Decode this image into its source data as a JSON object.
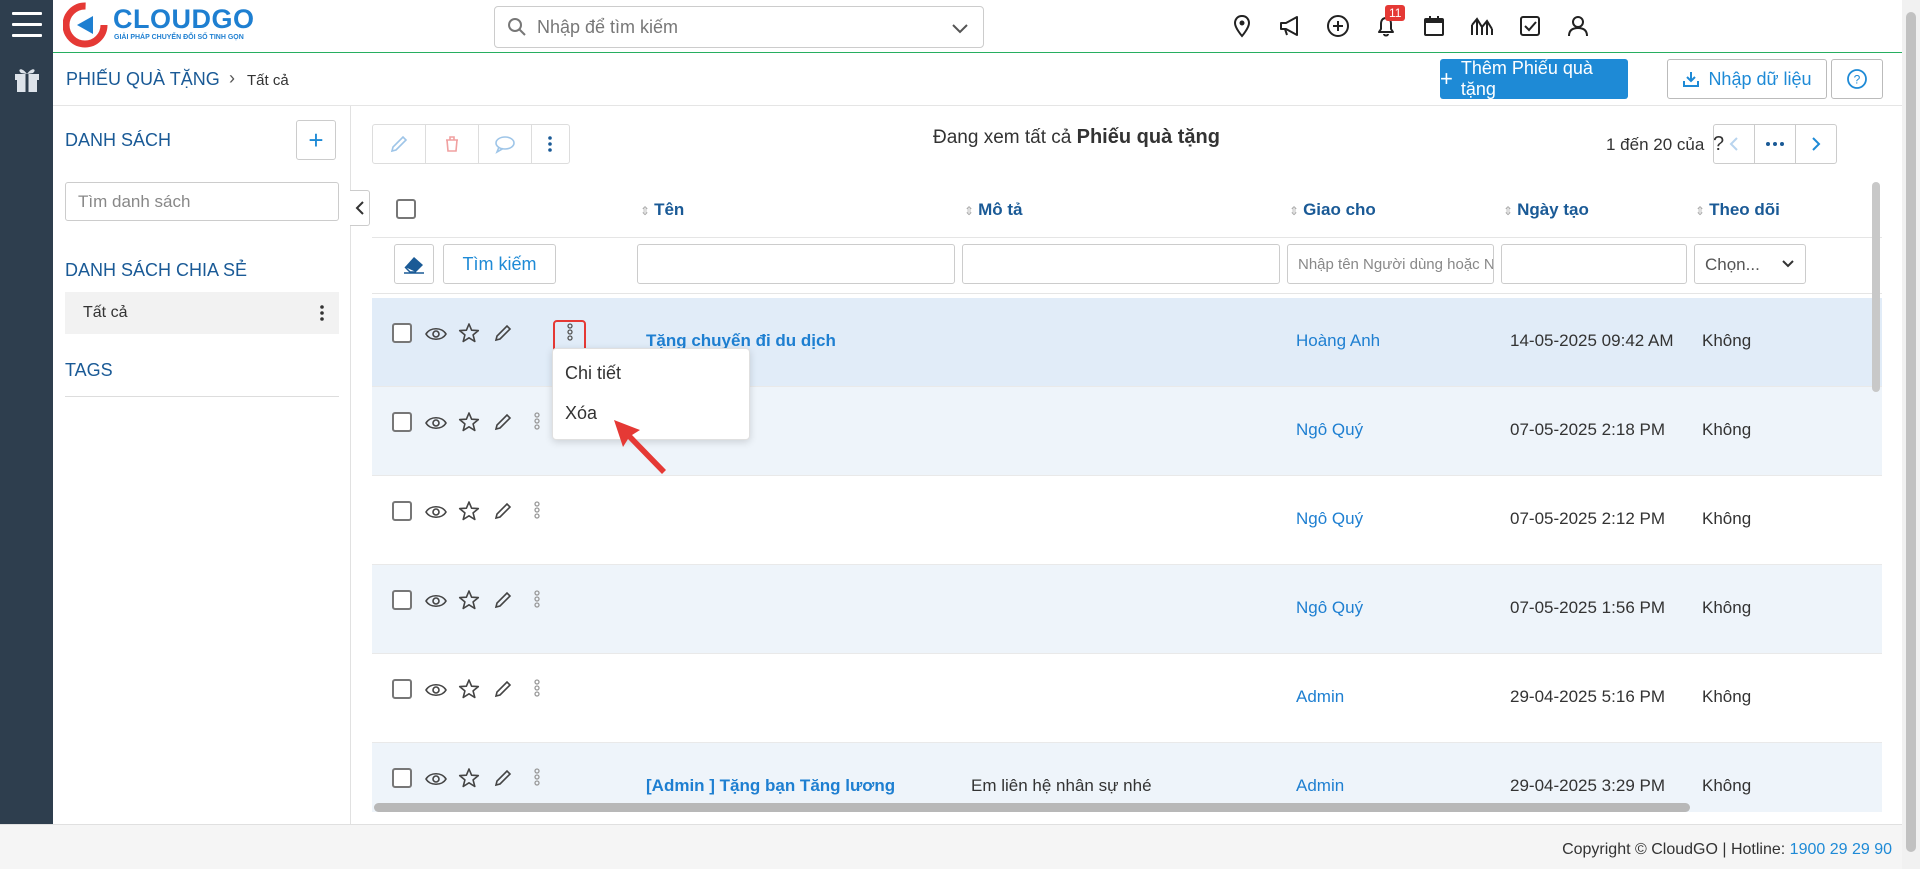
{
  "app": {
    "brand": "CLOUDGO",
    "tagline": "GIẢI PHÁP CHUYỂN ĐỔI SỐ TINH GỌN",
    "search_placeholder": "Nhập để tìm kiếm",
    "notification_count": "11"
  },
  "breadcrumb": {
    "module": "PHIẾU QUÀ TẶNG",
    "current": "Tất cả",
    "add_button": "Thêm Phiếu quà tặng",
    "import_button": "Nhập dữ liệu"
  },
  "sidebar": {
    "list_heading": "DANH SÁCH",
    "search_placeholder": "Tìm danh sách",
    "shared_heading": "DANH SÁCH CHIA SẺ",
    "shared_items": [
      "Tất cả"
    ],
    "tags_heading": "TAGS"
  },
  "main": {
    "viewing_prefix": "Đang xem tất cả",
    "viewing_module": "Phiếu quà tặng",
    "pager_text": "1 đến 20 của",
    "pager_help": "?",
    "columns": [
      "Tên",
      "Mô tả",
      "Giao cho",
      "Ngày tạo",
      "Theo dõi"
    ],
    "filter": {
      "search_button": "Tìm kiếm",
      "assignee_placeholder": "Nhập tên Người dùng hoặc Nhóm",
      "follow_select": "Chọn..."
    },
    "rows": [
      {
        "name": "Tặng chuyến đi du dịch",
        "desc": "",
        "assignee": "Hoàng Anh",
        "created": "14-05-2025 09:42 AM",
        "follow": "Không"
      },
      {
        "name": "",
        "desc": "",
        "assignee": "Ngô Quý",
        "created": "07-05-2025 2:18 PM",
        "follow": "Không"
      },
      {
        "name": "",
        "desc": "",
        "assignee": "Ngô Quý",
        "created": "07-05-2025 2:12 PM",
        "follow": "Không"
      },
      {
        "name": "",
        "desc": "",
        "assignee": "Ngô Quý",
        "created": "07-05-2025 1:56 PM",
        "follow": "Không"
      },
      {
        "name": "",
        "desc": "",
        "assignee": "Admin",
        "created": "29-04-2025 5:16 PM",
        "follow": "Không"
      },
      {
        "name": "[Admin ] Tặng bạn Tăng lương",
        "desc": "Em liên hệ nhân sự nhé",
        "assignee": "Admin",
        "created": "29-04-2025 3:29 PM",
        "follow": "Không"
      }
    ]
  },
  "row_menu": {
    "items": [
      "Chi tiết",
      "Xóa"
    ]
  },
  "footer": {
    "copyright": "Copyright © CloudGO",
    "hotline_label": "Hotline:",
    "hotline": "1900 29 29 90"
  },
  "colors": {
    "primary": "#1e8ad6",
    "heading": "#1a5a96",
    "rail": "#2e3e4e",
    "highlight": "#e53935"
  }
}
